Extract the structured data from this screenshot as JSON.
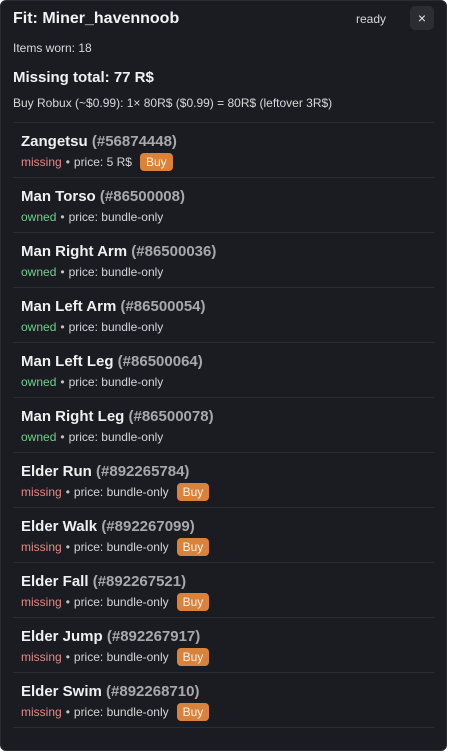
{
  "header": {
    "title": "Fit: Miner_havennoob",
    "status": "ready",
    "close_label": "×"
  },
  "summary": {
    "items_worn": "Items worn: 18",
    "missing_total": "Missing total: 77 R$",
    "buy_robux": "Buy Robux (~$0.99): 1× 80R$ ($0.99) = 80R$ (leftover 3R$)"
  },
  "labels": {
    "price_prefix": "price:",
    "buy": "Buy",
    "bullet": "•"
  },
  "items": [
    {
      "name": "Zangetsu",
      "id": "(#56874448)",
      "status": "missing",
      "price": "5 R$",
      "buy": true
    },
    {
      "name": "Man Torso",
      "id": "(#86500008)",
      "status": "owned",
      "price": "bundle-only",
      "buy": false
    },
    {
      "name": "Man Right Arm",
      "id": "(#86500036)",
      "status": "owned",
      "price": "bundle-only",
      "buy": false
    },
    {
      "name": "Man Left Arm",
      "id": "(#86500054)",
      "status": "owned",
      "price": "bundle-only",
      "buy": false
    },
    {
      "name": "Man Left Leg",
      "id": "(#86500064)",
      "status": "owned",
      "price": "bundle-only",
      "buy": false
    },
    {
      "name": "Man Right Leg",
      "id": "(#86500078)",
      "status": "owned",
      "price": "bundle-only",
      "buy": false
    },
    {
      "name": "Elder Run",
      "id": "(#892265784)",
      "status": "missing",
      "price": "bundle-only",
      "buy": true
    },
    {
      "name": "Elder Walk",
      "id": "(#892267099)",
      "status": "missing",
      "price": "bundle-only",
      "buy": true
    },
    {
      "name": "Elder Fall",
      "id": "(#892267521)",
      "status": "missing",
      "price": "bundle-only",
      "buy": true
    },
    {
      "name": "Elder Jump",
      "id": "(#892267917)",
      "status": "missing",
      "price": "bundle-only",
      "buy": true
    },
    {
      "name": "Elder Swim",
      "id": "(#892268710)",
      "status": "missing",
      "price": "bundle-only",
      "buy": true
    }
  ],
  "colors": {
    "panel_bg": "#1b1c21",
    "missing": "#e58a86",
    "owned": "#6fd08a",
    "buy_button": "#d9823b"
  }
}
